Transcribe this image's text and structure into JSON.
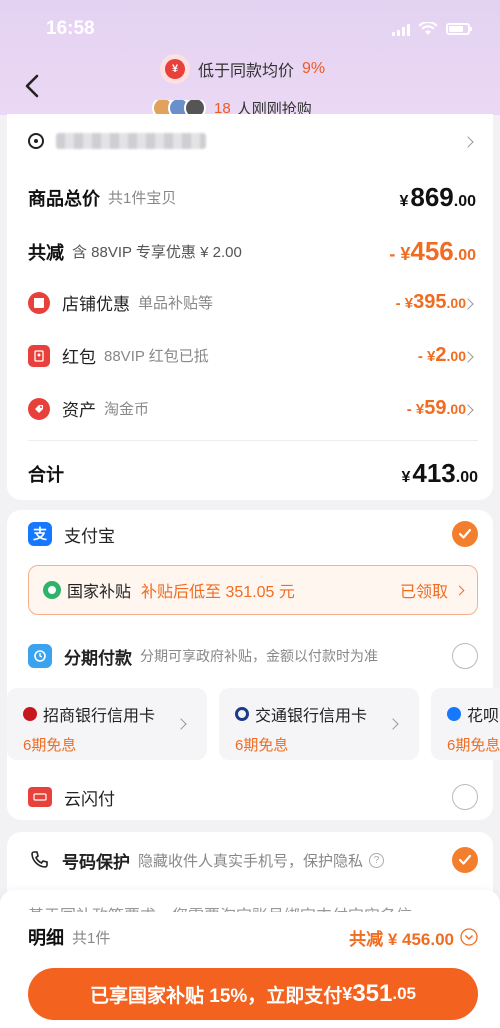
{
  "status": {
    "time": "16:58"
  },
  "promo": {
    "lowest_text": "低于同款均价",
    "lowest_pct": "9%",
    "buyers_num": "18",
    "buyers_text": "人刚刚抢购"
  },
  "summary": {
    "goods_total_label": "商品总价",
    "goods_count": "共1件宝贝",
    "goods_total": {
      "yen": "¥",
      "int": "869",
      "dec": ".00"
    },
    "discount_label": "共减",
    "discount_sub": "含 88VIP 专享优惠 ¥ 2.00",
    "discount_total": {
      "yen": "- ¥",
      "int": "456",
      "dec": ".00"
    },
    "items": [
      {
        "label": "店铺优惠",
        "sub": "单品补贴等",
        "yen": "- ¥",
        "int": "395",
        "dec": ".00",
        "icon": "shop-discount-icon"
      },
      {
        "label": "红包",
        "sub": "88VIP 红包已抵",
        "yen": "- ¥",
        "int": "2",
        "dec": ".00",
        "icon": "red-packet-icon"
      },
      {
        "label": "资产",
        "sub": "淘金币",
        "yen": "- ¥",
        "int": "59",
        "dec": ".00",
        "icon": "asset-tag-icon"
      }
    ],
    "total_label": "合计",
    "total": {
      "yen": "¥",
      "int": "413",
      "dec": ".00"
    }
  },
  "payment": {
    "alipay_label": "支付宝",
    "subsidy_name": "国家补贴",
    "subsidy_desc": "补贴后低至 351.05 元",
    "subsidy_status": "已领取",
    "installment_label": "分期付款",
    "installment_desc": "分期可享政府补贴，金额以付款时为准",
    "banks": [
      {
        "name": "招商银行信用卡",
        "plan": "6期免息"
      },
      {
        "name": "交通银行信用卡",
        "plan": "6期免息"
      },
      {
        "name": "花呗",
        "plan": "6期免息"
      }
    ],
    "unionpay_label": "云闪付"
  },
  "privacy": {
    "label": "号码保护",
    "desc": "隐藏收件人真实手机号，保护隐私"
  },
  "footer": {
    "notice": "基于国补政策要求，您需要淘宝账号绑定支付宝实名信",
    "detail_label": "明细",
    "detail_count": "共1件",
    "discount_text": "共减 ¥ 456.00",
    "pay_prefix": "已享国家补贴 15%，立即支付",
    "pay_yen": "¥",
    "pay_int": "351",
    "pay_dec": ".05"
  },
  "colors": {
    "accent": "#f3631f",
    "orange_text": "#f06c21",
    "header_bg": "#e4d2f2"
  }
}
